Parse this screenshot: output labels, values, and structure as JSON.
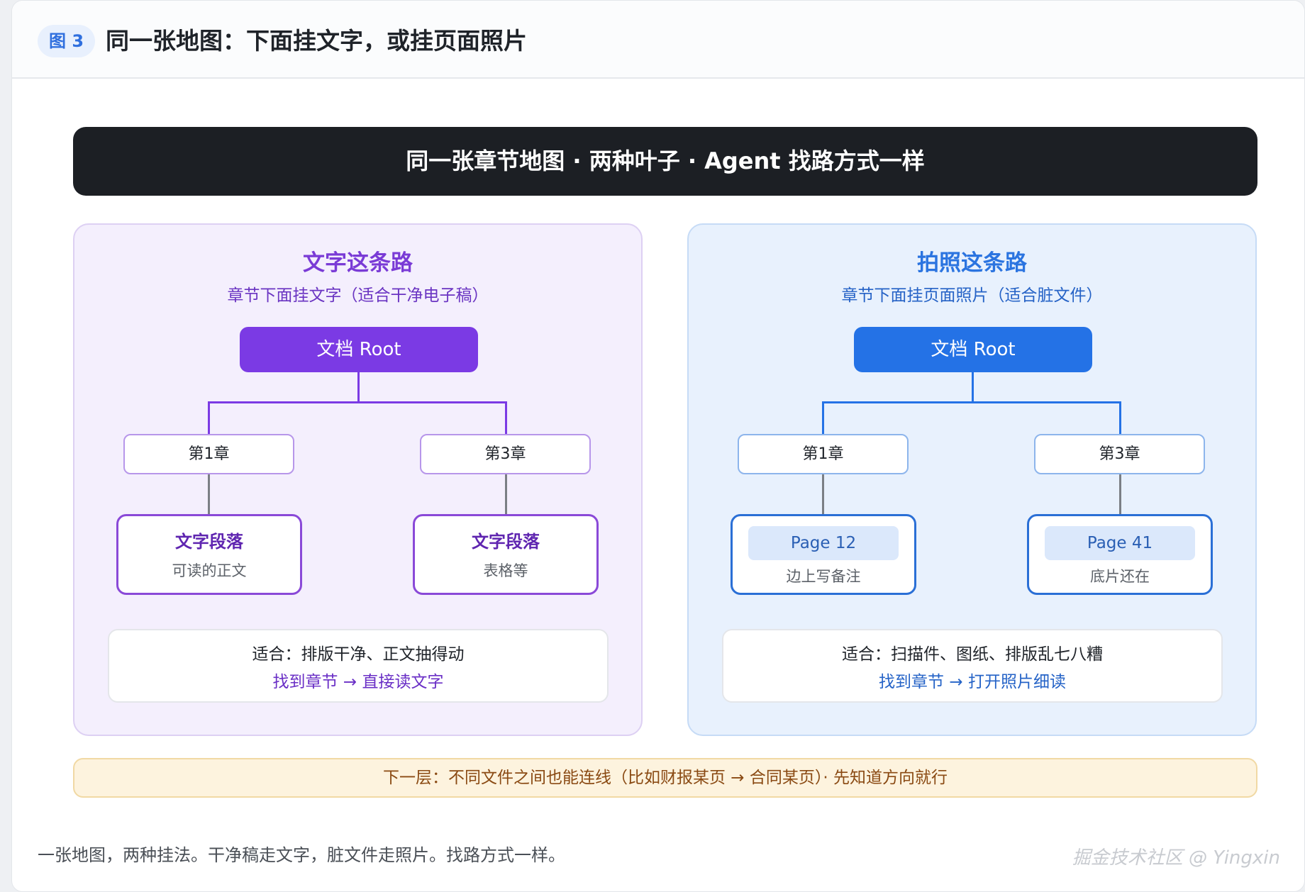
{
  "figure": {
    "badge": "图 3",
    "title": "同一张地图：下面挂文字，或挂页面照片"
  },
  "banner": "同一张章节地图 · 两种叶子 · Agent 找路方式一样",
  "left": {
    "title": "文字这条路",
    "subtitle": "章节下面挂文字（适合干净电子稿）",
    "root": "文档 Root",
    "chapters": [
      "第1章",
      "第3章"
    ],
    "leaves": [
      {
        "title": "文字段落",
        "desc": "可读的正文"
      },
      {
        "title": "文字段落",
        "desc": "表格等"
      }
    ],
    "suit": "适合：排版干净、正文抽得动",
    "path": "找到章节 → 直接读文字"
  },
  "right": {
    "title": "拍照这条路",
    "subtitle": "章节下面挂页面照片（适合脏文件）",
    "root": "文档 Root",
    "chapters": [
      "第1章",
      "第3章"
    ],
    "leaves": [
      {
        "page": "Page 12",
        "note": "边上写备注"
      },
      {
        "page": "Page 41",
        "note": "底片还在"
      }
    ],
    "suit": "适合：扫描件、图纸、排版乱七八糟",
    "path": "找到章节 → 打开照片细读"
  },
  "note": "下一层：不同文件之间也能连线（比如财报某页 → 合同某页）· 先知道方向就行",
  "caption": "一张地图，两种挂法。干净稿走文字，脏文件走照片。找路方式一样。",
  "watermark": "掘金技术社区 @ Yingxin",
  "colors": {
    "left_accent": "#7b3ae4",
    "right_accent": "#2472e6",
    "banner_bg": "#1c1f24",
    "note_bg": "#fdf3de"
  }
}
